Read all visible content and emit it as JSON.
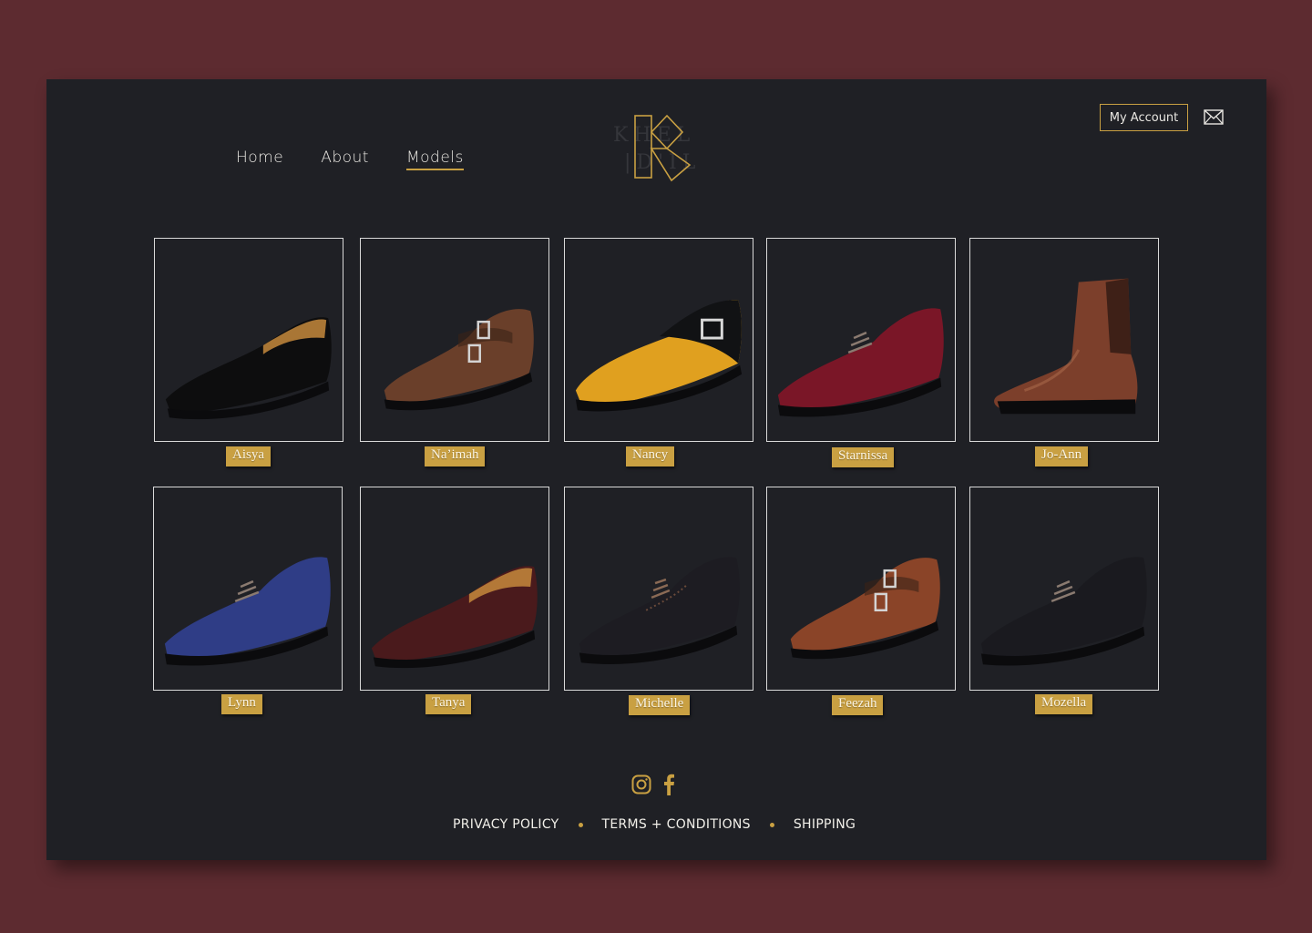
{
  "nav": {
    "items": [
      {
        "label": "Home",
        "active": false
      },
      {
        "label": "About",
        "active": false
      },
      {
        "label": "Models",
        "active": true
      }
    ]
  },
  "header": {
    "account_label": "My Account",
    "mail_icon": "mail-icon",
    "logo_icon": "k-monogram-logo"
  },
  "models": [
    {
      "name": "Aisya",
      "color": "#0d0d0e",
      "style": "loafer"
    },
    {
      "name": "Na’imah",
      "color": "#6a3f2a",
      "style": "monk"
    },
    {
      "name": "Nancy",
      "color": "#e0a01f",
      "style": "two-tone"
    },
    {
      "name": "Starnissa",
      "color": "#7a1627",
      "style": "oxford"
    },
    {
      "name": "Jo-Ann",
      "color": "#7c3f2b",
      "style": "chelsea"
    },
    {
      "name": "Lynn",
      "color": "#2f3d86",
      "style": "oxford"
    },
    {
      "name": "Tanya",
      "color": "#4a1a1c",
      "style": "loafer"
    },
    {
      "name": "Michelle",
      "color": "#1d1c22",
      "style": "brogue"
    },
    {
      "name": "Feezah",
      "color": "#8a4428",
      "style": "monk"
    },
    {
      "name": "Mozella",
      "color": "#1a1a1f",
      "style": "oxford"
    }
  ],
  "social": {
    "instagram_icon": "instagram-icon",
    "facebook_icon": "facebook-icon"
  },
  "footer": {
    "links": [
      "PRIVACY POLICY",
      "TERMS + CONDITIONS",
      "SHIPPING"
    ]
  },
  "colors": {
    "accent": "#c9a042",
    "panel": "#1f2025",
    "background": "#5d2b30"
  }
}
